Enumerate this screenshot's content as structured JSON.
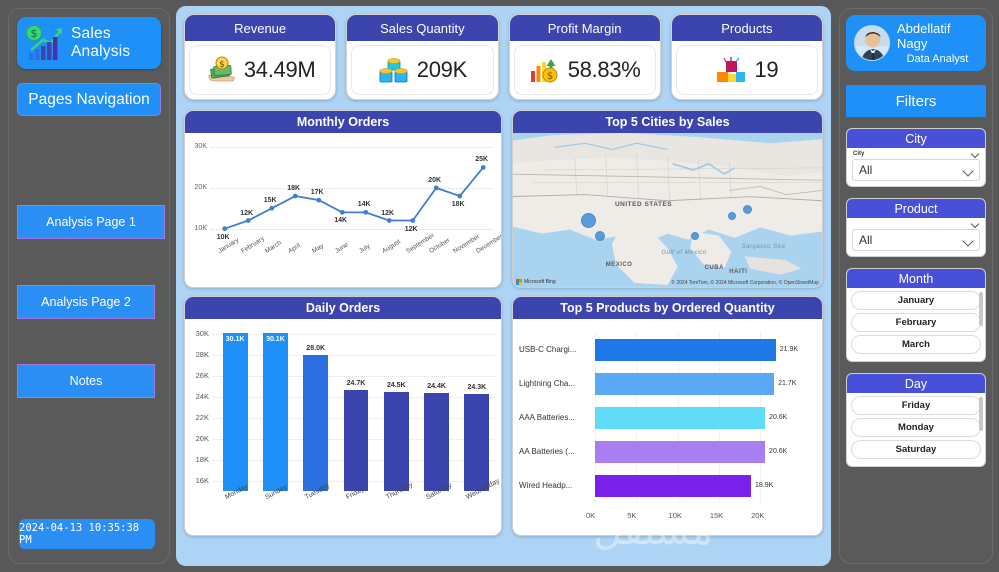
{
  "sidebar": {
    "logo_title": "Sales Analysis",
    "logo_icon": "bar-chart-growth-icon",
    "nav_header": "Pages Navigation",
    "nav_items": [
      {
        "label": "Analysis Page 1"
      },
      {
        "label": "Analysis Page 2"
      },
      {
        "label": "Notes"
      }
    ],
    "timestamp": "2024-04-13 10:35:38 PM"
  },
  "kpis": [
    {
      "title": "Revenue",
      "value": "34.49M",
      "icon": "money-hand-icon"
    },
    {
      "title": "Sales Quantity",
      "value": "209K",
      "icon": "boxes-icon"
    },
    {
      "title": "Profit Margin",
      "value": "58.83%",
      "icon": "growth-coin-icon"
    },
    {
      "title": "Products",
      "value": "19",
      "icon": "product-blocks-icon"
    }
  ],
  "cards": {
    "monthly_orders": "Monthly Orders",
    "top_cities": "Top 5 Cities by Sales",
    "daily_orders": "Daily Orders",
    "top_products": "Top 5 Products by Ordered Quantity"
  },
  "map": {
    "country_label": "UNITED STATES",
    "mexico_label": "MEXICO",
    "cuba_label": "CUBA",
    "gulf_label": "Gulf of Mexico",
    "sargasso_label": "Sargasso Sea",
    "haiti_label": "HAITI",
    "brand": "Microsoft Bing",
    "attribution": "© 2024 TomTom, © 2024 Microsoft Corporation, © OpenStreetMap"
  },
  "filters": {
    "header": "Filters",
    "city": {
      "title": "City",
      "field_label": "City",
      "value": "All"
    },
    "product": {
      "title": "Product",
      "field_label": "Product",
      "value": "All"
    },
    "month": {
      "title": "Month",
      "items": [
        "January",
        "February",
        "March"
      ]
    },
    "day": {
      "title": "Day",
      "items": [
        "Friday",
        "Monday",
        "Saturday"
      ]
    }
  },
  "user": {
    "name": "Abdellatif Nagy",
    "role": "Data Analyst",
    "avatar": "user-photo-avatar"
  },
  "chart_data": [
    {
      "type": "line",
      "title": "Monthly Orders",
      "categories": [
        "January",
        "February",
        "March",
        "April",
        "May",
        "June",
        "July",
        "August",
        "September",
        "October",
        "November",
        "December"
      ],
      "values": [
        10000,
        12000,
        15000,
        18000,
        17000,
        14000,
        14000,
        12000,
        12000,
        20000,
        18000,
        25000
      ],
      "labels": [
        "10K",
        "12K",
        "15K",
        "18K",
        "17K",
        "14K",
        "14K",
        "12K",
        "12K",
        "20K",
        "18K",
        "25K"
      ],
      "yticks": [
        "10K",
        "20K",
        "30K"
      ],
      "ytick_values": [
        10000,
        20000,
        30000
      ],
      "ylim": [
        6000,
        31000
      ],
      "xlabel": "",
      "ylabel": "",
      "grid": true,
      "color": "#3f7fd0"
    },
    {
      "type": "bar",
      "title": "Daily Orders",
      "categories": [
        "Monday",
        "Sunday",
        "Tuesday",
        "Friday",
        "Thursday",
        "Saturday",
        "Wednesday"
      ],
      "values": [
        30100,
        30100,
        28000,
        24700,
        24500,
        24400,
        24300
      ],
      "labels": [
        "30.1K",
        "30.1K",
        "28.0K",
        "24.7K",
        "24.5K",
        "24.4K",
        "24.3K"
      ],
      "colors": [
        "#1e90f7",
        "#1e90f7",
        "#2b6fe0",
        "#3b45ad",
        "#3b45ad",
        "#3b45ad",
        "#3b45ad"
      ],
      "yticks": [
        "16K",
        "18K",
        "20K",
        "22K",
        "24K",
        "26K",
        "28K",
        "30K"
      ],
      "ytick_values": [
        16000,
        18000,
        20000,
        22000,
        24000,
        26000,
        28000,
        30000
      ],
      "ylim": [
        15000,
        30500
      ],
      "xlabel": "",
      "ylabel": "",
      "grid": true
    },
    {
      "type": "bar",
      "orientation": "horizontal",
      "title": "Top 5 Products by Ordered Quantity",
      "categories": [
        "USB-C Chargi...",
        "Lightning Cha...",
        "AAA Batteries...",
        "AA Batteries (...",
        "Wired Headp..."
      ],
      "values": [
        21900,
        21700,
        20600,
        20600,
        18900
      ],
      "labels": [
        "21.9K",
        "21.7K",
        "20.6K",
        "20.6K",
        "18.9K"
      ],
      "colors": [
        "#1f78e8",
        "#5aa9f5",
        "#5fdcf7",
        "#a97ef0",
        "#7a22ec"
      ],
      "xticks": [
        "0K",
        "5K",
        "10K",
        "15K",
        "20K"
      ],
      "xtick_values": [
        0,
        5000,
        10000,
        15000,
        20000
      ],
      "xlim": [
        0,
        23500
      ],
      "xlabel": "",
      "ylabel": "",
      "grid": true
    },
    {
      "type": "scatter",
      "title": "Top 5 Cities by Sales",
      "map": true,
      "points": [
        {
          "x": 23.5,
          "y": 56.0,
          "size": 15
        },
        {
          "x": 27.0,
          "y": 66.5,
          "size": 10
        },
        {
          "x": 75.5,
          "y": 49.5,
          "size": 9
        },
        {
          "x": 70.5,
          "y": 53.5,
          "size": 8
        },
        {
          "x": 58.0,
          "y": 66.0,
          "size": 8
        }
      ]
    }
  ]
}
